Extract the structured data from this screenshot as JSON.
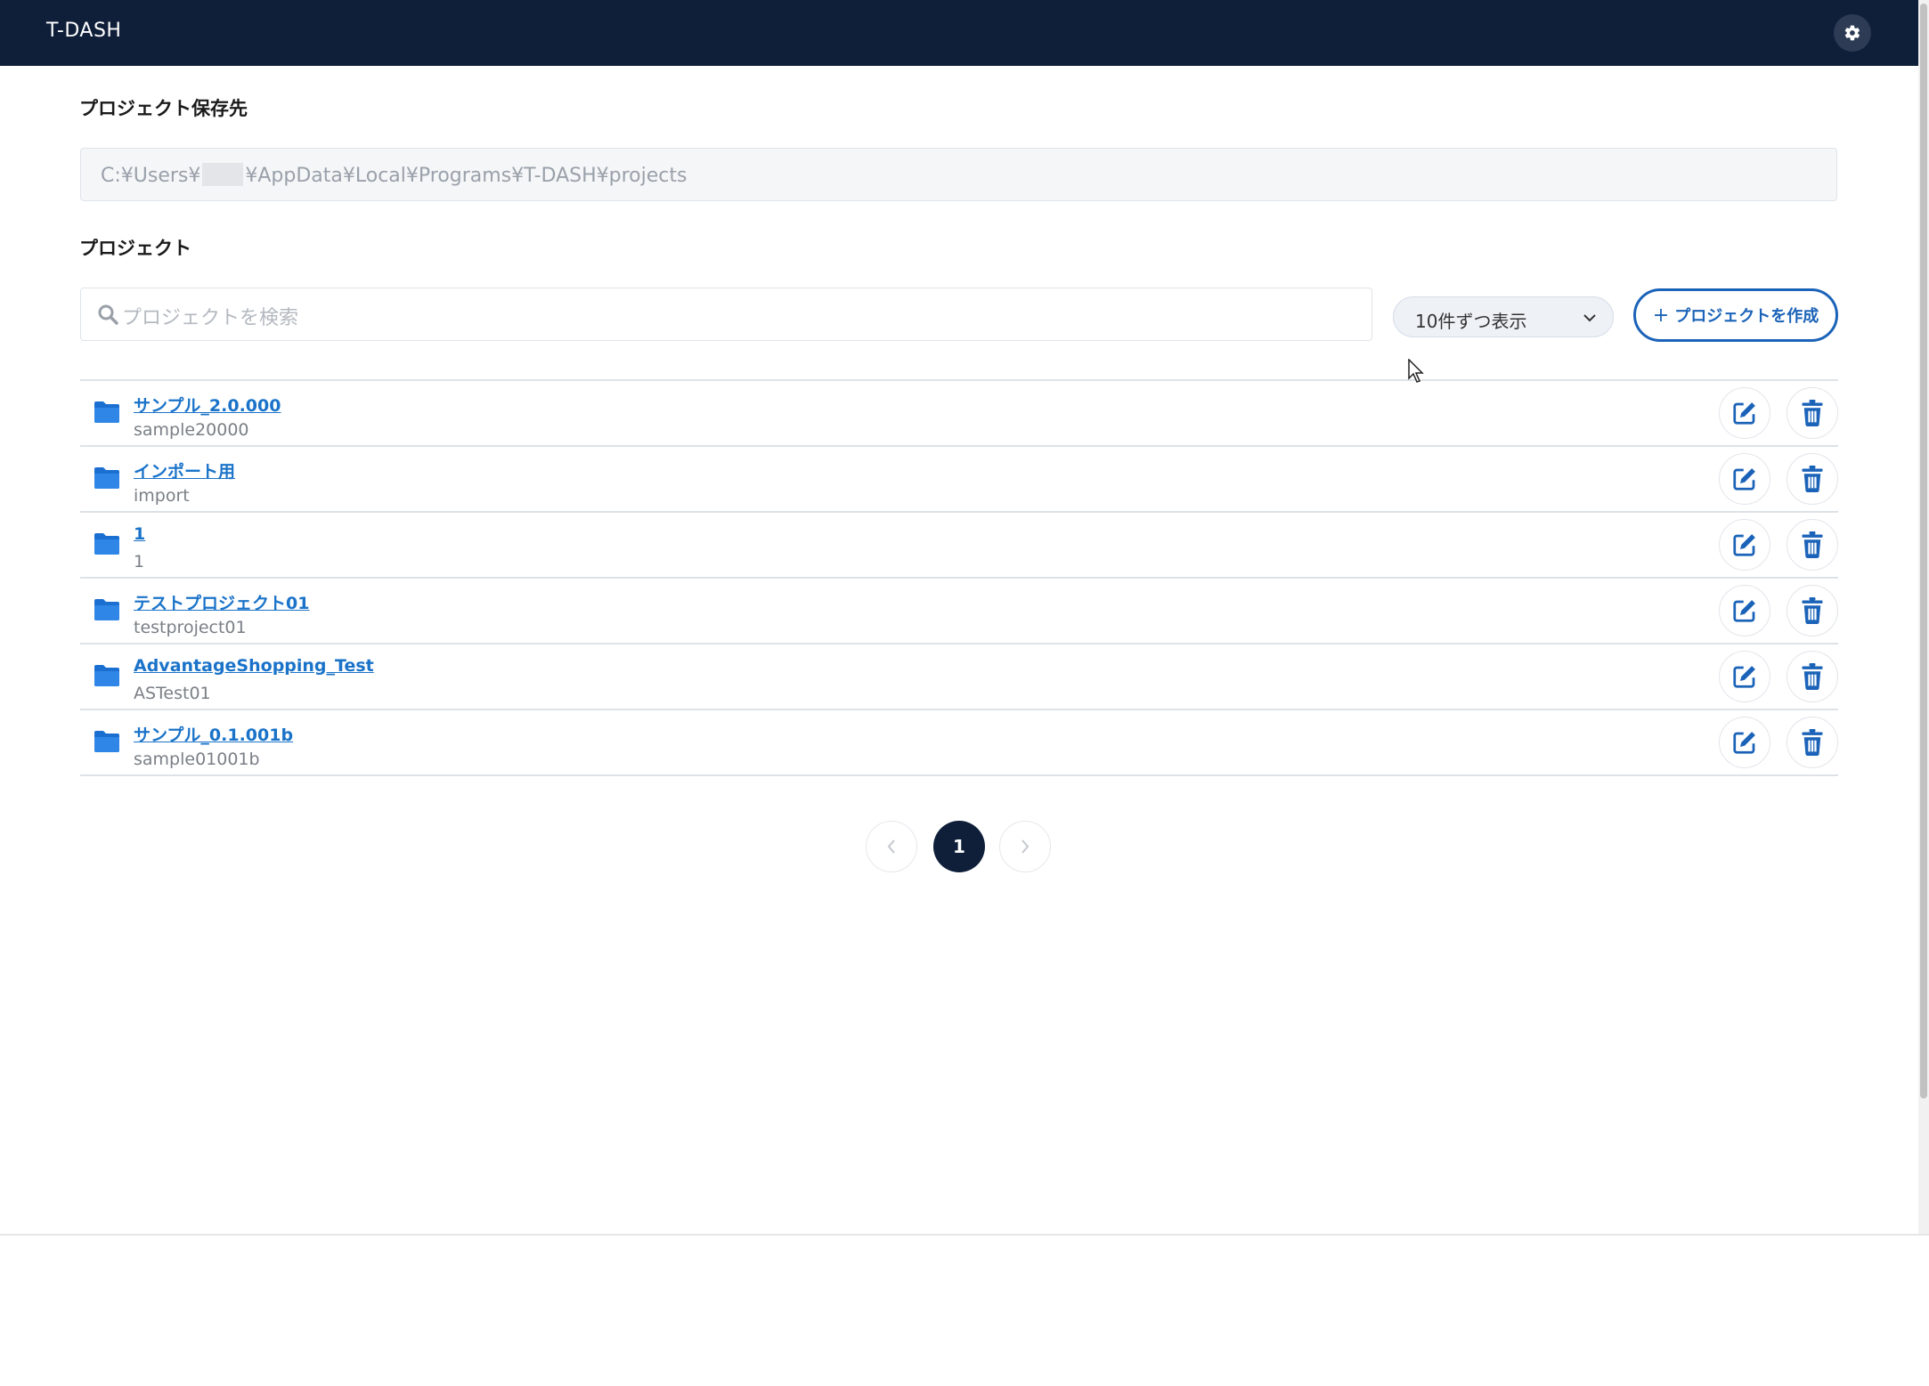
{
  "header": {
    "title": "T-DASH",
    "settings_icon": "gear-icon"
  },
  "storage": {
    "label": "プロジェクト保存先",
    "path_prefix": "C:¥Users¥",
    "path_suffix": "¥AppData¥Local¥Programs¥T-DASH¥projects"
  },
  "projects_section": {
    "label": "プロジェクト",
    "search_placeholder": "プロジェクトを検索",
    "page_size_label": "10件ずつ表示",
    "create_label": "プロジェクトを作成",
    "create_plus": "+"
  },
  "projects": [
    {
      "name": "サンプル_2.0.000",
      "code": "sample20000"
    },
    {
      "name": "インポート用",
      "code": "import"
    },
    {
      "name": "1",
      "code": "1"
    },
    {
      "name": "テストプロジェクト01",
      "code": "testproject01"
    },
    {
      "name": "AdvantageShopping_Test",
      "code": "ASTest01"
    },
    {
      "name": "サンプル_0.1.001b",
      "code": "sample01001b"
    }
  ],
  "pagination": {
    "current_page": "1",
    "prev_icon": "chevron-left-icon",
    "next_icon": "chevron-right-icon"
  },
  "colors": {
    "header_bg": "#0f1f3a",
    "accent": "#1b63b8",
    "link": "#1a73c9"
  }
}
